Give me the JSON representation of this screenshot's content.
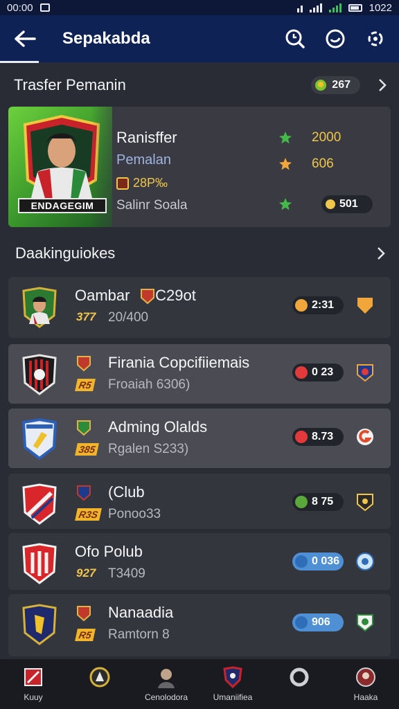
{
  "status_bar": {
    "time": "00:00",
    "clock": "1022"
  },
  "header": {
    "title": "Sepakabda"
  },
  "transfer_section": {
    "title": "Trasfer Pemanin",
    "count": "267"
  },
  "featured": {
    "art_banner": "ENDAGEGIM",
    "title": "Ranisffer",
    "subtitle": "Pemalan",
    "rating": "28P‰",
    "club": "Salinr Soala",
    "stat1": "2000",
    "stat2": "606",
    "pill_value": "501"
  },
  "list_section": {
    "title": "Daakinguiokes"
  },
  "rows": [
    {
      "name": "Oambar",
      "name2": "C29ot",
      "rating": "377",
      "sub": "20/400",
      "pill": "2:31"
    },
    {
      "name": "Firania Copcifiiemais",
      "rating": "R5",
      "sub": "Froaiah 6306)",
      "pill": "0 23"
    },
    {
      "name": "Adming Olalds",
      "rating": "385",
      "sub": "Rgalen S233)",
      "pill": "8.73"
    },
    {
      "name": "(Club",
      "rating": "R3S",
      "sub": "Ponoo33",
      "pill": "8 75"
    },
    {
      "name": "Ofo Polub",
      "rating": "927",
      "sub": "T3409",
      "pill": "0 036"
    },
    {
      "name": "Nanaadia",
      "rating": "R5",
      "sub": "Ramtorn 8",
      "pill": "906"
    }
  ],
  "bottom_nav": [
    {
      "label": "Kuuy"
    },
    {
      "label": ""
    },
    {
      "label": "Cenolodora"
    },
    {
      "label": "Umaniifiea"
    },
    {
      "label": ""
    },
    {
      "label": "Haaka"
    }
  ],
  "colors": {
    "header": "#0f2256",
    "background": "#2a2c35",
    "accent": "#f0c64c"
  }
}
